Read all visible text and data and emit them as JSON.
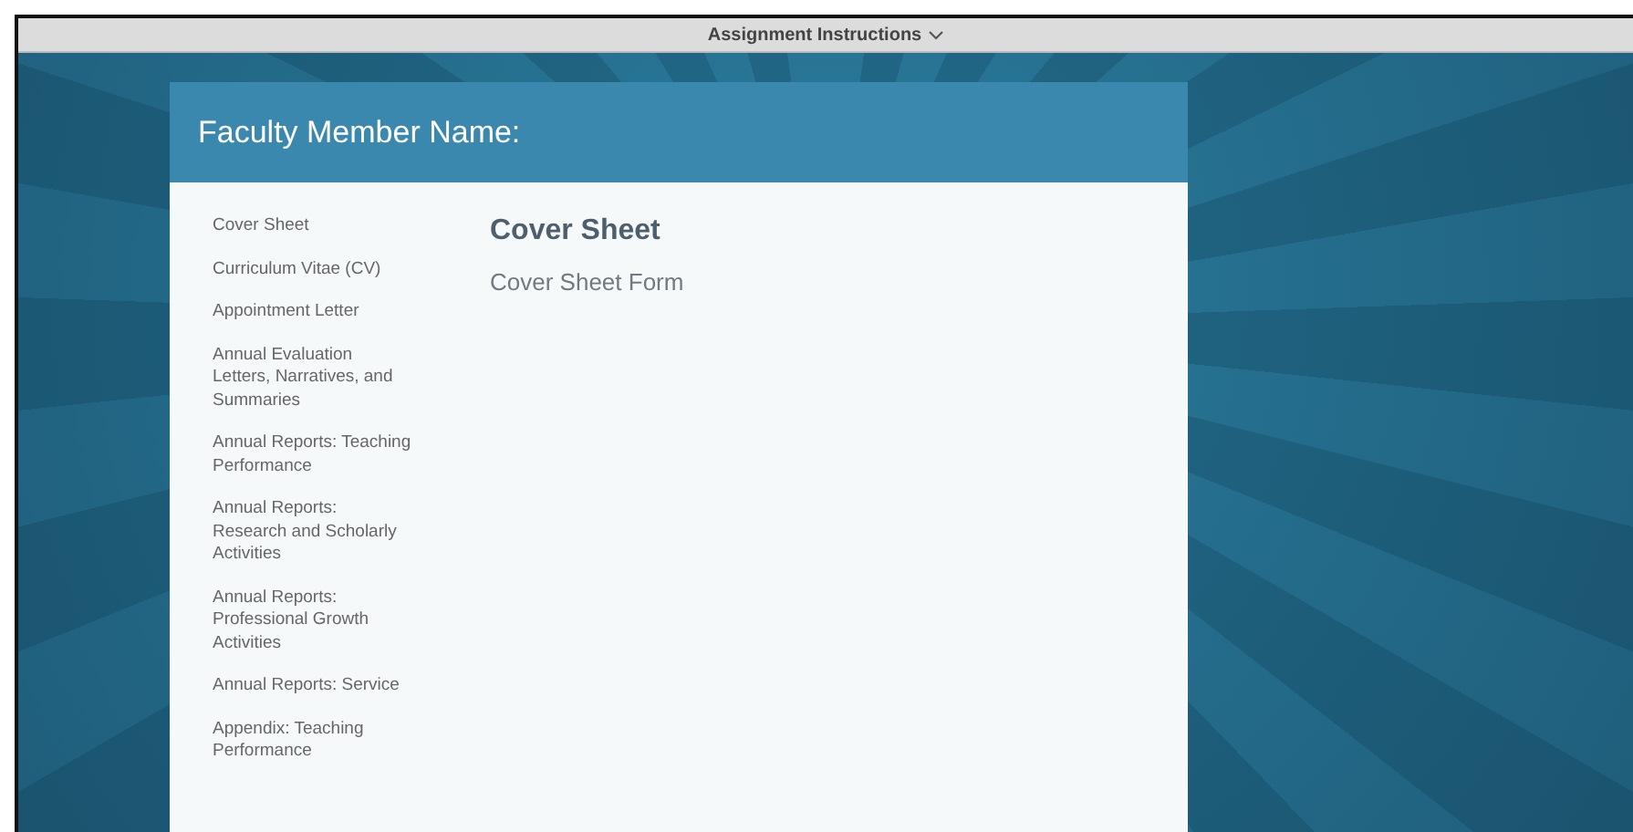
{
  "top_bar": {
    "title": "Assignment Instructions"
  },
  "card": {
    "title": "Faculty Member Name:"
  },
  "sidebar": {
    "items": [
      {
        "label": "Cover Sheet"
      },
      {
        "label": "Curriculum Vitae (CV)"
      },
      {
        "label": "Appointment Letter"
      },
      {
        "label": "Annual Evaluation Letters, Narratives, and Summaries"
      },
      {
        "label": "Annual Reports: Teaching Performance"
      },
      {
        "label": "Annual Reports: Research and Scholarly Activities"
      },
      {
        "label": "Annual Reports: Professional Growth Activities"
      },
      {
        "label": "Annual Reports: Service"
      },
      {
        "label": "Appendix: Teaching Performance"
      }
    ]
  },
  "content": {
    "heading": "Cover Sheet",
    "body": "Cover Sheet Form"
  }
}
